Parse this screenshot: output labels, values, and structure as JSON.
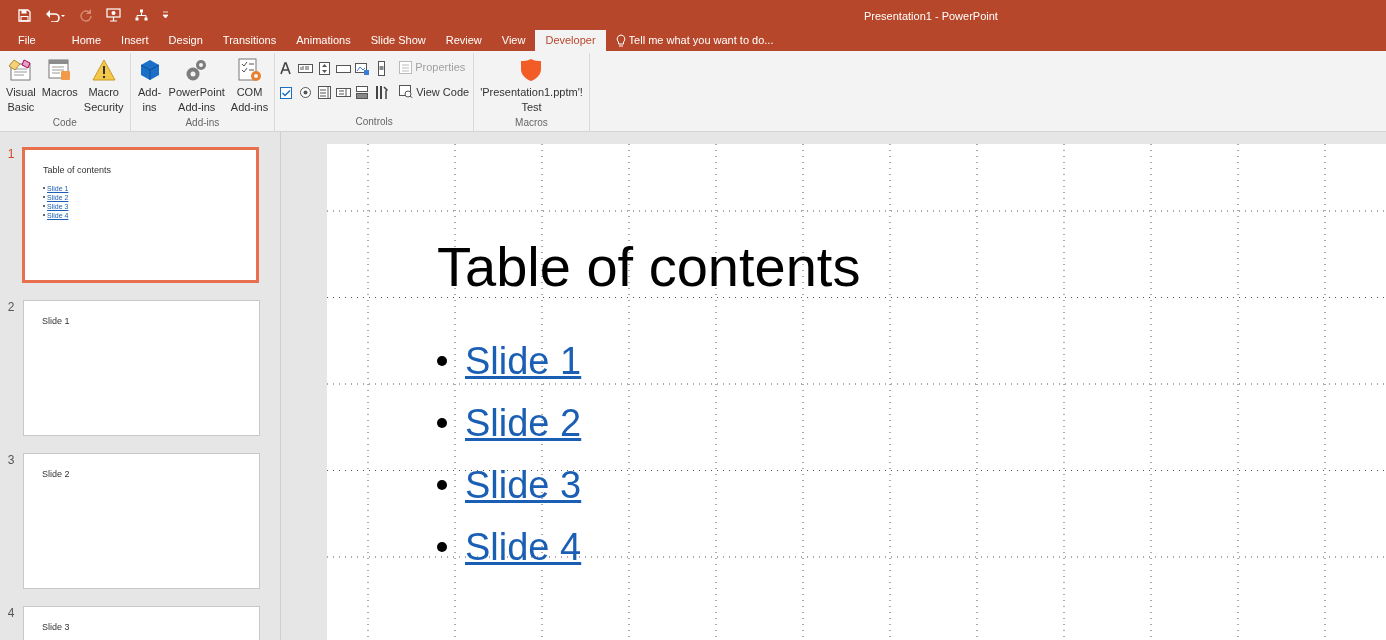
{
  "window": {
    "title": "Presentation1 - PowerPoint"
  },
  "tabs": [
    {
      "label": "File",
      "selected": false
    },
    {
      "label": "Home",
      "selected": false
    },
    {
      "label": "Insert",
      "selected": false
    },
    {
      "label": "Design",
      "selected": false
    },
    {
      "label": "Transitions",
      "selected": false
    },
    {
      "label": "Animations",
      "selected": false
    },
    {
      "label": "Slide Show",
      "selected": false
    },
    {
      "label": "Review",
      "selected": false
    },
    {
      "label": "View",
      "selected": false
    },
    {
      "label": "Developer",
      "selected": true
    }
  ],
  "tell_me": {
    "placeholder": "Tell me what you want to do..."
  },
  "ribbon": {
    "groups": [
      {
        "name": "Code",
        "buttons": [
          {
            "kind": "vba",
            "lines": [
              "Visual",
              "Basic"
            ]
          },
          {
            "kind": "macros",
            "lines": [
              "Macros"
            ]
          },
          {
            "kind": "security",
            "lines": [
              "Macro",
              "Security"
            ]
          }
        ]
      },
      {
        "name": "Add-ins",
        "buttons": [
          {
            "kind": "addins",
            "lines": [
              "Add-",
              "ins"
            ]
          },
          {
            "kind": "pptaddins",
            "lines": [
              "PowerPoint",
              "Add-ins"
            ]
          },
          {
            "kind": "comaddins",
            "lines": [
              "COM",
              "Add-ins"
            ]
          }
        ]
      },
      {
        "name": "Controls",
        "kind": "controls",
        "commands": [
          {
            "label": "Properties",
            "disabled": true
          },
          {
            "label": "View Code",
            "disabled": false
          }
        ]
      },
      {
        "name": "Macros",
        "buttons": [
          {
            "kind": "shield",
            "lines": [
              "'Presentation1.pptm'!",
              "Test"
            ]
          }
        ]
      }
    ]
  },
  "slides": [
    {
      "number": "1",
      "title": "Table of contents",
      "links": [
        "Slide 1",
        "Slide 2",
        "Slide 3",
        "Slide 4"
      ],
      "selected": true
    },
    {
      "number": "2",
      "title": "Slide 1",
      "selected": false
    },
    {
      "number": "3",
      "title": "Slide 2",
      "selected": false
    },
    {
      "number": "4",
      "title": "Slide 3",
      "selected": false
    }
  ],
  "current_slide": {
    "title": "Table of contents",
    "links": [
      "Slide 1",
      "Slide 2",
      "Slide 3",
      "Slide 4"
    ]
  }
}
